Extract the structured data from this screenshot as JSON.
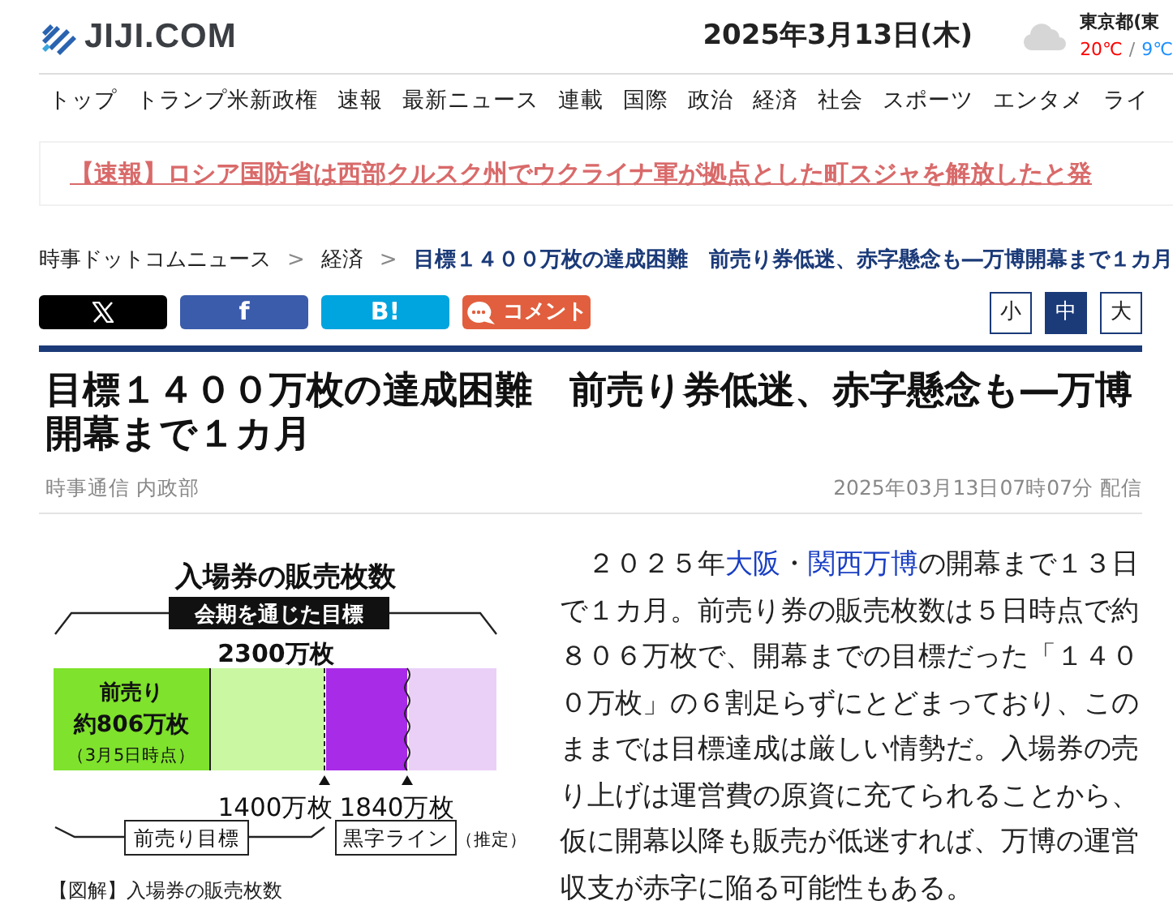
{
  "header": {
    "site_name": "JIJI.COM",
    "date": "2025年3月13日(木)",
    "weather": {
      "location": "東京都(東",
      "high": "20℃",
      "separator": "/",
      "low": "9℃"
    }
  },
  "nav": [
    {
      "label": "トップ"
    },
    {
      "label": "トランプ米新政権"
    },
    {
      "label": "速報"
    },
    {
      "label": "最新ニュース"
    },
    {
      "label": "連載"
    },
    {
      "label": "国際"
    },
    {
      "label": "政治"
    },
    {
      "label": "経済"
    },
    {
      "label": "社会"
    },
    {
      "label": "スポーツ"
    },
    {
      "label": "エンタメ"
    },
    {
      "label": "ライ"
    }
  ],
  "ticker": {
    "text": "【速報】ロシア国防省は西部クルスク州でウクライナ軍が拠点とした町スジャを解放したと発"
  },
  "breadcrumb": [
    {
      "label": "時事ドットコムニュース",
      "current": false
    },
    {
      "separator": ">",
      "label": "経済",
      "current": false
    },
    {
      "separator": ">",
      "label": "目標１４００万枚の達成困難　前売り券低迷、赤字懸念も―万博開幕まで１カ月",
      "current": true
    }
  ],
  "share_buttons": [
    {
      "kind": "x"
    },
    {
      "kind": "facebook",
      "label": "f"
    },
    {
      "kind": "hatena",
      "label": "B!"
    },
    {
      "kind": "comment",
      "label": "コメント"
    }
  ],
  "font_size_buttons": [
    {
      "label": "小",
      "selected": false
    },
    {
      "label": "中",
      "selected": true
    },
    {
      "label": "大",
      "selected": false
    }
  ],
  "article": {
    "title": "目標１４００万枚の達成困難　前売り券低迷、赤字懸念も―万博開幕まで１カ月",
    "byline": "時事通信 内政部",
    "timestamp": "2025年03月13日07時07分 配信",
    "figure": {
      "title": "入場券の販売枚数",
      "target_label": "会期を通じた目標",
      "total": "2300万枚",
      "presale_lines": [
        "前売り",
        "約806万枚",
        "（3月5日時点）"
      ],
      "markers": [
        "1400万枚",
        "1840万枚"
      ],
      "presale_target": "前売り目標",
      "breakeven": "黒字ライン",
      "breakeven_note": "（推定）"
    },
    "caption": "【図解】入場券の販売枚数",
    "body": [
      {
        "text": "２０２５年",
        "link": false
      },
      {
        "text": "大阪",
        "link": true
      },
      {
        "text": "・",
        "link": false
      },
      {
        "text": "関西万博",
        "link": true
      },
      {
        "text": "の開幕まで１３日で１カ月。前売り券の販売枚数は５日時点で約８０６万枚で、開幕までの目標だった「１４００万枚」の６割足らずにとどまっており、このままでは目標達成は厳しい情勢だ。入場券の売り上げは運営費の原資に充てられることから、仮に開幕以降も販売が低迷すれば、万博の運営収支が赤字に陥る可能性もある。",
        "link": false
      }
    ]
  }
}
